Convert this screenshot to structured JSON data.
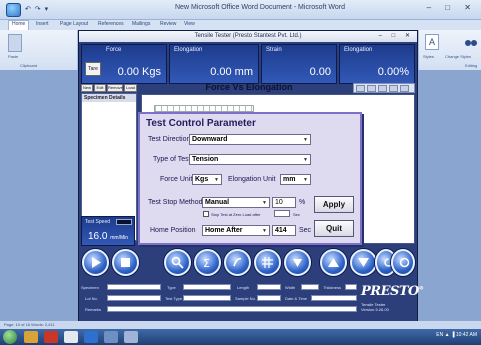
{
  "word": {
    "title": "New Microsoft Office Word Document - Microsoft Word",
    "quick_access": "↶ ↷ ▾",
    "window_buttons": "– □ ✕",
    "tabs": [
      "Home",
      "Insert",
      "Page Layout",
      "References",
      "Mailings",
      "Review",
      "View"
    ],
    "ribbon_left": [
      "Paste",
      "Clipboard"
    ],
    "ribbon_right": [
      "Styles",
      "Change Styles",
      "Editing"
    ],
    "status_text": "Page: 10 of 16   Words: 2,411",
    "tray_text": "EN  ▲  ▐  10:42 AM"
  },
  "app": {
    "title": "Tensile Tester  (Presto Stantest Pvt. Ltd.)",
    "window_buttons": "– □ ✕",
    "tare_label": "Tare",
    "readouts": [
      {
        "label": "Force",
        "value": "0.00 Kgs"
      },
      {
        "label": "Elongation",
        "value": "0.00 mm"
      },
      {
        "label": "Strain",
        "value": "0.00"
      },
      {
        "label": "Elongation",
        "value": "0.00%"
      }
    ],
    "spec_toolbar": [
      "New",
      "Edit",
      "Remove",
      "Load"
    ],
    "spec_header": "Specimen Details",
    "chart_title": "Force Vs Elongation",
    "test_speed": {
      "label": "Test Speed",
      "value": "16.0",
      "unit": "mm/Min"
    },
    "icon_buttons": [
      "play-icon",
      "stop-icon",
      "zoom-icon",
      "sigma-icon",
      "report-icon",
      "grid-icon",
      "down-arrow-icon",
      "up-icon",
      "down-icon",
      "reset-icon",
      "exit-icon"
    ],
    "form": {
      "labels": [
        "Specimen",
        "Type",
        "Length",
        "Width",
        "Thickness",
        "Lot No.",
        "Test Type",
        "Sample No.",
        "Date & Time",
        "Remarks"
      ],
      "logo": "PRESTO",
      "logo_reg": "®",
      "sub_lines": [
        "Tensile Tester",
        "Version 5.26.00"
      ]
    }
  },
  "dialog": {
    "title": "Test Control Parameter",
    "test_direction_label": "Test Direction",
    "test_direction_value": "Downward",
    "type_of_test_label": "Type of Test",
    "type_of_test_value": "Tension",
    "force_unit_label": "Force Unit",
    "force_unit_value": "Kgs",
    "elongation_unit_label": "Elongation Unit",
    "elongation_unit_value": "mm",
    "stop_method_label": "Test Stop Method",
    "stop_method_value": "Manual",
    "stop_value": "10",
    "stop_unit": "%",
    "zero_load_label": "Stop Test at Zero Load after",
    "zero_load_unit": "Sec",
    "home_position_label": "Home Position",
    "home_position_value": "Home After",
    "home_seconds": "414",
    "home_seconds_unit": "Sec",
    "apply_label": "Apply",
    "quit_label": "Quit"
  }
}
